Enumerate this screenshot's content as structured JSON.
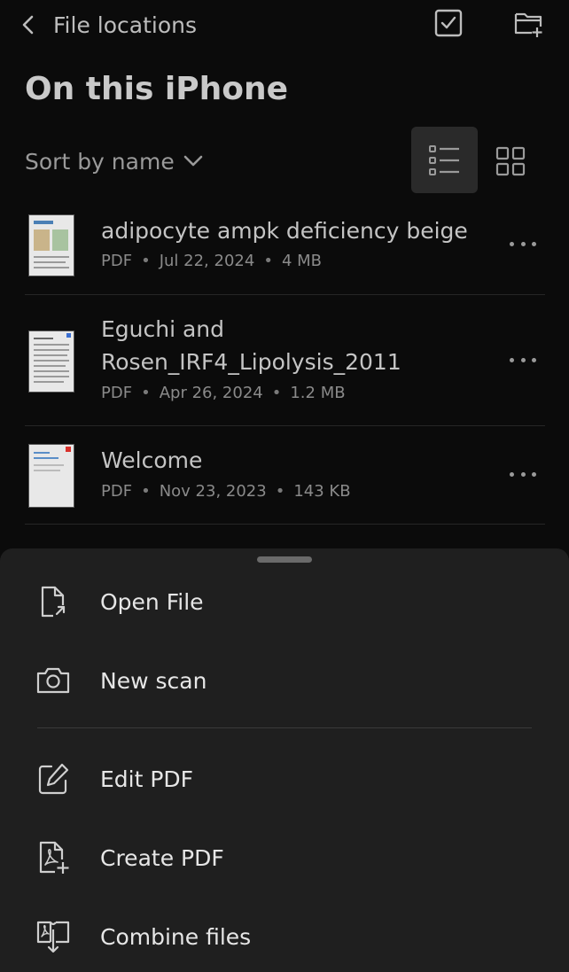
{
  "header": {
    "back_label": "File locations",
    "select_icon": "checkbox-icon",
    "new_folder_icon": "folder-add-icon",
    "title": "On this iPhone"
  },
  "toolbar": {
    "sort_label": "Sort by name",
    "view_mode": "list"
  },
  "files": [
    {
      "name_lines": [
        "adipocyte ampk deficiency beige"
      ],
      "type": "PDF",
      "date": "Jul 22, 2024",
      "size": "4 MB"
    },
    {
      "name_lines": [
        "Eguchi and",
        "Rosen_IRF4_Lipolysis_2011"
      ],
      "type": "PDF",
      "date": "Apr 26, 2024",
      "size": "1.2 MB"
    },
    {
      "name_lines": [
        "Welcome"
      ],
      "type": "PDF",
      "date": "Nov 23, 2023",
      "size": "143 KB"
    }
  ],
  "sheet": {
    "items": [
      {
        "label": "Open File",
        "icon": "open-file-icon"
      },
      {
        "label": "New scan",
        "icon": "camera-icon"
      },
      {
        "label": "Edit PDF",
        "icon": "edit-pdf-icon"
      },
      {
        "label": "Create PDF",
        "icon": "create-pdf-icon"
      },
      {
        "label": "Combine files",
        "icon": "combine-files-icon"
      }
    ]
  },
  "colors": {
    "background": "#0b0b0b",
    "sheet": "#1f1f1f",
    "text_primary": "#e6e6e6",
    "text_secondary": "#8a8a8a",
    "pdf_red": "#d9312b"
  }
}
